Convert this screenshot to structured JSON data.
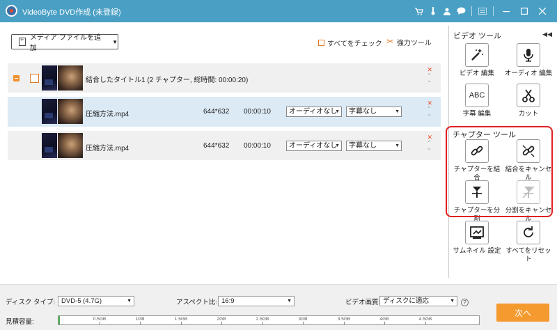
{
  "app": {
    "title": "VideoByte DVD作成 (未登録)"
  },
  "titlebar_icons": [
    "cart-icon",
    "thermometer-icon",
    "account-icon",
    "chat-icon",
    "menu-icon",
    "minimize-icon",
    "maximize-icon",
    "close-icon"
  ],
  "toolbar": {
    "add_media_label": "メディア ファイルを追加",
    "check_all_label": "すべてをチェック",
    "power_tool_label": "強力ツール"
  },
  "title_row": {
    "text": "結合したタイトル1 (2 チャプター, 総時間: 00:00:20)"
  },
  "files": [
    {
      "name": "圧縮方法.mp4",
      "resolution": "644*632",
      "duration": "00:00:10",
      "audio": "オーディオなし",
      "subtitle": "字幕なし"
    },
    {
      "name": "圧縮方法.mp4",
      "resolution": "644*632",
      "duration": "00:00:10",
      "audio": "オーディオなし",
      "subtitle": "字幕なし"
    }
  ],
  "panel": {
    "video_tools_title": "ビデオ ツール",
    "video_edit": "ビデオ 編集",
    "audio_edit": "オーディオ 編集",
    "abc": "ABC",
    "subtitle_edit": "字幕 編集",
    "cut": "カット",
    "chapter_tools_title": "チャプター ツール",
    "merge_chapter": "チャプターを結合",
    "cancel_merge": "結合をキャンセル",
    "split_chapter": "チャプターを分割",
    "cancel_split": "分割をキャンセル",
    "thumbnail_setting": "サムネイル 設定",
    "reset_all": "すべてをリセット"
  },
  "bottom": {
    "disc_type_label": "ディスク タイプ:",
    "disc_type_value": "DVD-5 (4.7G)",
    "aspect_label": "アスペクト比:",
    "aspect_value": "16:9",
    "quality_label": "ビデオ画質:",
    "quality_value": "ディスクに適応",
    "capacity_label": "見積容量:",
    "capacity_ticks": [
      "0.5GB",
      "1GB",
      "1.5GB",
      "2GB",
      "2.5GB",
      "3GB",
      "3.5GB",
      "4GB",
      "4.5GB"
    ],
    "capacity_used_fraction": 0.003,
    "next_label": "次へ"
  },
  "colors": {
    "titlebar": "#4a9fc4",
    "accent": "#f49a2f",
    "highlight": "#e02020",
    "selected_row": "#dceaf5"
  }
}
